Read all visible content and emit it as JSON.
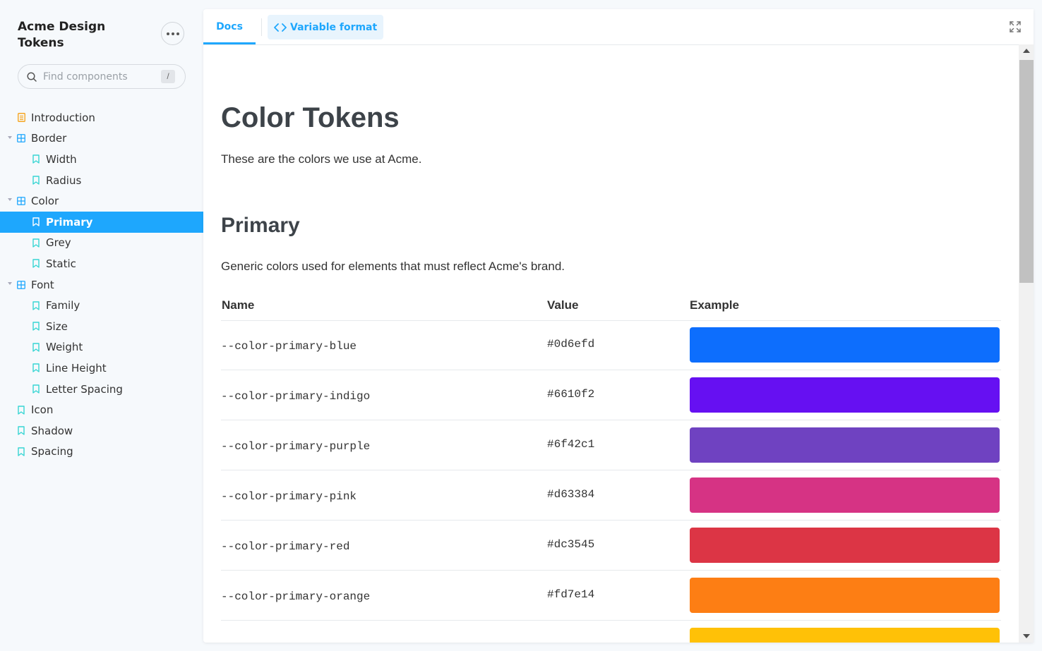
{
  "sidebar": {
    "brand": "Acme Design Tokens",
    "search_placeholder": "Find components",
    "search_shortcut": "/",
    "items": [
      {
        "label": "Introduction",
        "level": 0,
        "icon": "document-icon"
      },
      {
        "label": "Border",
        "level": 0,
        "icon": "component-icon",
        "expanded": true
      },
      {
        "label": "Width",
        "level": 1,
        "icon": "bookmark-icon"
      },
      {
        "label": "Radius",
        "level": 1,
        "icon": "bookmark-icon"
      },
      {
        "label": "Color",
        "level": 0,
        "icon": "component-icon",
        "expanded": true
      },
      {
        "label": "Primary",
        "level": 1,
        "icon": "bookmark-icon",
        "active": true
      },
      {
        "label": "Grey",
        "level": 1,
        "icon": "bookmark-icon"
      },
      {
        "label": "Static",
        "level": 1,
        "icon": "bookmark-icon"
      },
      {
        "label": "Font",
        "level": 0,
        "icon": "component-icon",
        "expanded": true
      },
      {
        "label": "Family",
        "level": 1,
        "icon": "bookmark-icon"
      },
      {
        "label": "Size",
        "level": 1,
        "icon": "bookmark-icon"
      },
      {
        "label": "Weight",
        "level": 1,
        "icon": "bookmark-icon"
      },
      {
        "label": "Line Height",
        "level": 1,
        "icon": "bookmark-icon"
      },
      {
        "label": "Letter Spacing",
        "level": 1,
        "icon": "bookmark-icon"
      },
      {
        "label": "Icon",
        "level": 0,
        "icon": "bookmark-icon"
      },
      {
        "label": "Shadow",
        "level": 0,
        "icon": "bookmark-icon"
      },
      {
        "label": "Spacing",
        "level": 0,
        "icon": "bookmark-icon"
      }
    ]
  },
  "tabs": {
    "docs": "Docs",
    "variable_format": "Variable format"
  },
  "content": {
    "title": "Color Tokens",
    "intro": "These are the colors we use at Acme.",
    "section_title": "Primary",
    "section_desc": "Generic colors used for elements that must reflect Acme's brand.",
    "table": {
      "headers": [
        "Name",
        "Value",
        "Example"
      ],
      "rows": [
        {
          "name": "--color-primary-blue",
          "value": "#0d6efd",
          "color": "#0d6efd"
        },
        {
          "name": "--color-primary-indigo",
          "value": "#6610f2",
          "color": "#6610f2"
        },
        {
          "name": "--color-primary-purple",
          "value": "#6f42c1",
          "color": "#6f42c1"
        },
        {
          "name": "--color-primary-pink",
          "value": "#d63384",
          "color": "#d63384"
        },
        {
          "name": "--color-primary-red",
          "value": "#dc3545",
          "color": "#dc3545"
        },
        {
          "name": "--color-primary-orange",
          "value": "#fd7e14",
          "color": "#fd7e14"
        },
        {
          "name": "",
          "value": "",
          "color": "#ffc107"
        }
      ]
    }
  },
  "colors": {
    "accent": "#1ea7fd",
    "doc_icon": "#f5a623",
    "bookmark_icon": "#37d5d3",
    "component_icon": "#1ea7fd"
  }
}
